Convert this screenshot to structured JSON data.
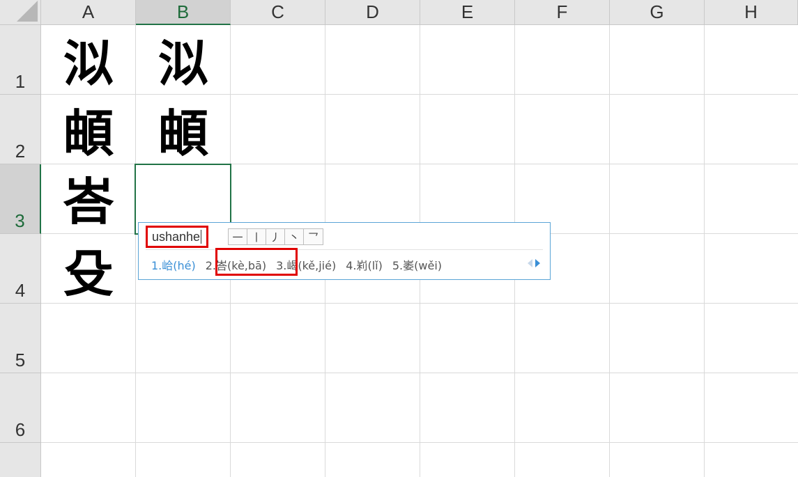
{
  "columns": [
    "A",
    "B",
    "C",
    "D",
    "E",
    "F",
    "G",
    "H"
  ],
  "active_column": "B",
  "rows": [
    "1",
    "2",
    "3",
    "4",
    "5",
    "6"
  ],
  "active_row": "3",
  "cells": {
    "A1": "泤",
    "B1": "泤",
    "A2": "頔",
    "B2": "頔",
    "A3": "峇",
    "A4": "殳"
  },
  "ime": {
    "input": "ushanhe",
    "strokes": [
      "一",
      "丨",
      "丿",
      "丶",
      "乛"
    ],
    "candidates": [
      "1.峆(hé)",
      "2.峇(kè,bā)",
      "3.嵑(kě,jié)",
      "4.峲(lǐ)",
      "5.崣(wěi)"
    ]
  },
  "colors": {
    "accent": "#217346",
    "ime_border": "#5aa4d6",
    "annotation_red": "#e00000",
    "candidate_first": "#3a8fd6"
  },
  "icons": [
    "prev-page-icon",
    "next-page-icon"
  ]
}
